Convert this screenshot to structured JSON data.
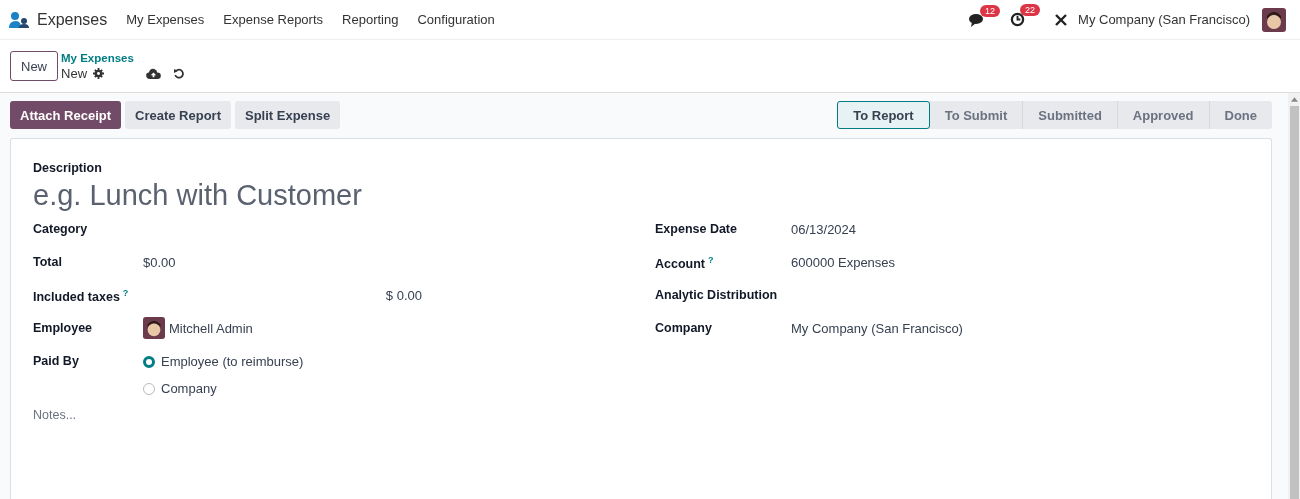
{
  "navbar": {
    "app_name": "Expenses",
    "menu": [
      "My Expenses",
      "Expense Reports",
      "Reporting",
      "Configuration"
    ],
    "messages_count": "12",
    "activities_count": "22",
    "company": "My Company (San Francisco)"
  },
  "control_panel": {
    "new_button": "New",
    "breadcrumb_parent": "My Expenses",
    "breadcrumb_current": "New"
  },
  "actions": [
    {
      "label": "Attach Receipt",
      "kind": "primary"
    },
    {
      "label": "Create Report",
      "kind": "secondary"
    },
    {
      "label": "Split Expense",
      "kind": "secondary"
    }
  ],
  "stages": [
    {
      "label": "To Report",
      "selected": true
    },
    {
      "label": "To Submit",
      "selected": false
    },
    {
      "label": "Submitted",
      "selected": false
    },
    {
      "label": "Approved",
      "selected": false
    },
    {
      "label": "Done",
      "selected": false
    }
  ],
  "form": {
    "description_label": "Description",
    "description_placeholder": "e.g. Lunch with Customer",
    "left_fields": [
      {
        "label": "Category",
        "kind": "text"
      },
      {
        "label": "Total",
        "kind": "text",
        "value": "$0.00"
      },
      {
        "label": "Included taxes",
        "kind": "amount",
        "help": "?",
        "value": "$ 0.00"
      },
      {
        "label": "Employee",
        "kind": "employee",
        "value": "Mitchell Admin"
      },
      {
        "label": "Paid By",
        "kind": "radio",
        "options": [
          {
            "label": "Employee (to reimburse)",
            "selected": true
          },
          {
            "label": "Company",
            "selected": false
          }
        ]
      }
    ],
    "right_fields": [
      {
        "label": "Expense Date",
        "kind": "text",
        "value": "06/13/2024"
      },
      {
        "label": "Account",
        "kind": "text",
        "help": "?",
        "value": "600000 Expenses"
      },
      {
        "label": "Analytic Distribution",
        "kind": "text"
      },
      {
        "label": "Company",
        "kind": "text",
        "value": "My Company (San Francisco)"
      }
    ],
    "notes_placeholder": "Notes..."
  }
}
